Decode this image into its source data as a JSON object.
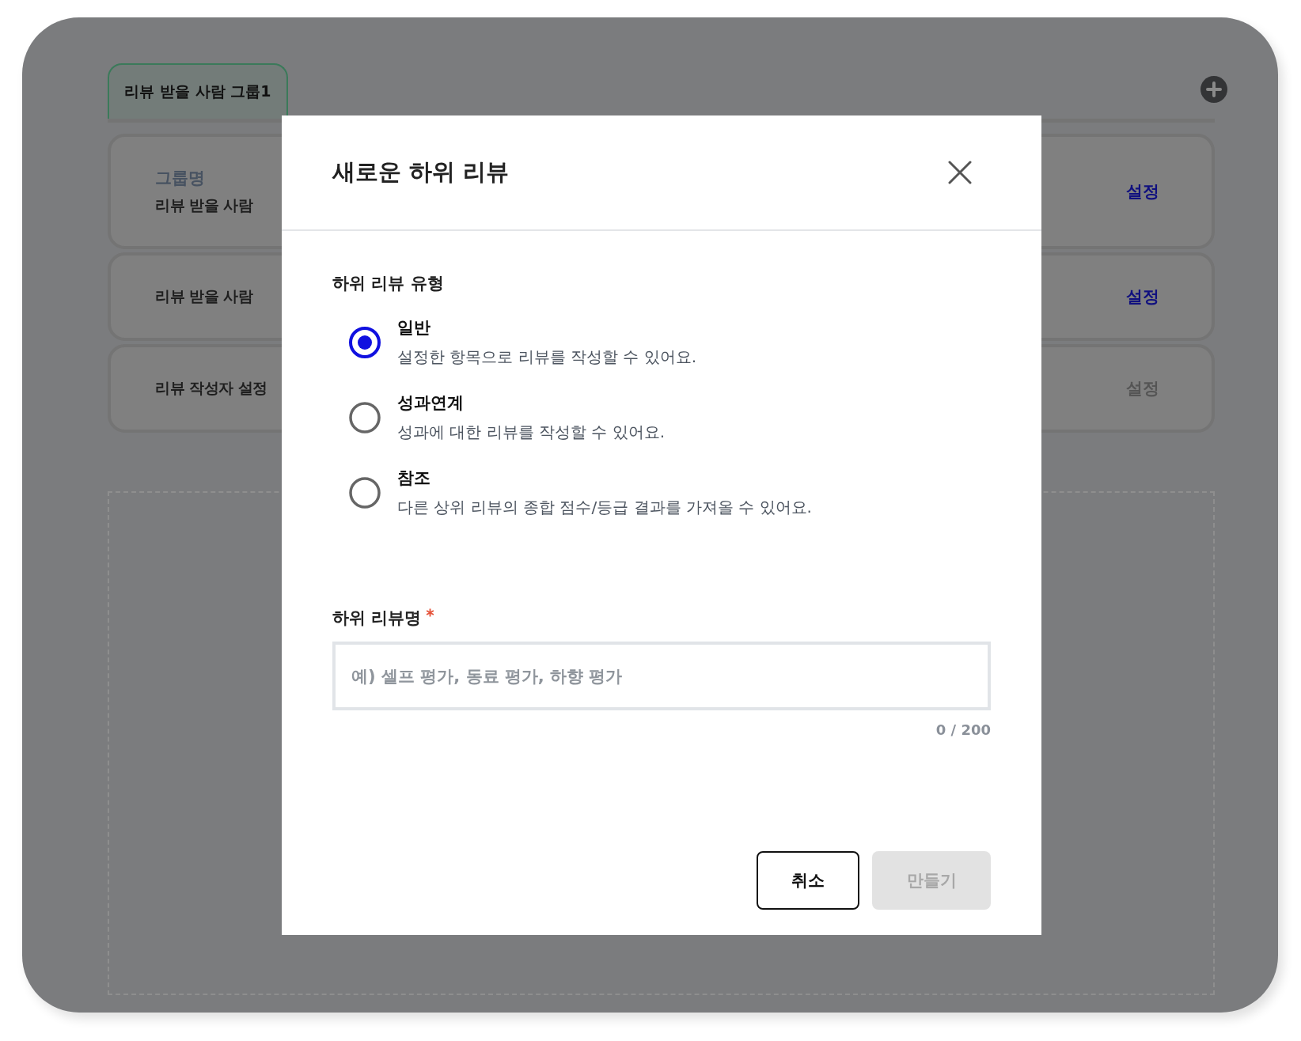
{
  "background": {
    "tabs": [
      {
        "label": "리뷰 받을 사람 그룹1",
        "selected": true
      }
    ],
    "rows": [
      {
        "kind": "field",
        "label": "그룹명",
        "value": "리뷰 받을 사람",
        "action": "설정",
        "disabled": false
      },
      {
        "kind": "plain",
        "value": "리뷰 받을 사람",
        "action": "설정",
        "disabled": false
      },
      {
        "kind": "plain",
        "value": "리뷰 작성자 설정",
        "action": "설정",
        "disabled": true
      }
    ]
  },
  "dialog": {
    "title": "새로운 하위 리뷰",
    "type_label": "하위 리뷰 유형",
    "options": [
      {
        "title": "일반",
        "description": "설정한 항목으로 리뷰를 작성할 수 있어요.",
        "selected": true
      },
      {
        "title": "성과연계",
        "description": "성과에 대한 리뷰를 작성할 수 있어요.",
        "selected": false
      },
      {
        "title": "참조",
        "description": "다른 상위 리뷰의 종합 점수/등급 결과를 가져올 수 있어요.",
        "selected": false
      }
    ],
    "name_label": "하위 리뷰명",
    "required": true,
    "placeholder": "예) 셀프 평가, 동료 평가, 하향 평가",
    "counter": "0 / 200",
    "buttons": [
      {
        "label": "취소",
        "kind": "secondary",
        "disabled": false
      },
      {
        "label": "만들기",
        "kind": "primary",
        "disabled": true
      }
    ]
  }
}
